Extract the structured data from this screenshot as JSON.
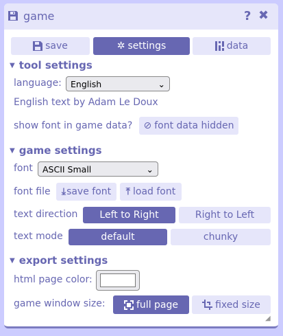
{
  "window": {
    "title": "game",
    "icon": "floppy-disk-icon",
    "help_icon": "question-icon",
    "close_icon": "close-icon"
  },
  "tabs": [
    {
      "label": "save",
      "icon": "floppy-disk-icon",
      "active": false
    },
    {
      "label": "settings",
      "icon": "gear-icon",
      "active": true
    },
    {
      "label": "data",
      "icon": "data-icon",
      "active": false
    }
  ],
  "tool_settings": {
    "heading": "tool settings",
    "language_label": "language:",
    "language_value": "English",
    "credit": "English text by Adam Le Doux",
    "show_font_label": "show font in game data?",
    "font_data_button": "font data hidden"
  },
  "game_settings": {
    "heading": "game settings",
    "font_label": "font",
    "font_value": "ASCII Small",
    "font_file_label": "font file",
    "save_font": "save font",
    "load_font": "load font",
    "text_direction_label": "text direction",
    "ltr": "Left to Right",
    "rtl": "Right to Left",
    "text_direction_selected": "Left to Right",
    "text_mode_label": "text mode",
    "mode_default": "default",
    "mode_chunky": "chunky",
    "text_mode_selected": "default"
  },
  "export_settings": {
    "heading": "export settings",
    "page_color_label": "html page color:",
    "page_color": "#ffffff",
    "window_size_label": "game window size:",
    "full_page": "full page",
    "fixed_size": "fixed size",
    "window_size_selected": "full page"
  },
  "colors": {
    "accent": "#6767b2",
    "light": "#e6e6fa",
    "background": "#ccccff"
  }
}
